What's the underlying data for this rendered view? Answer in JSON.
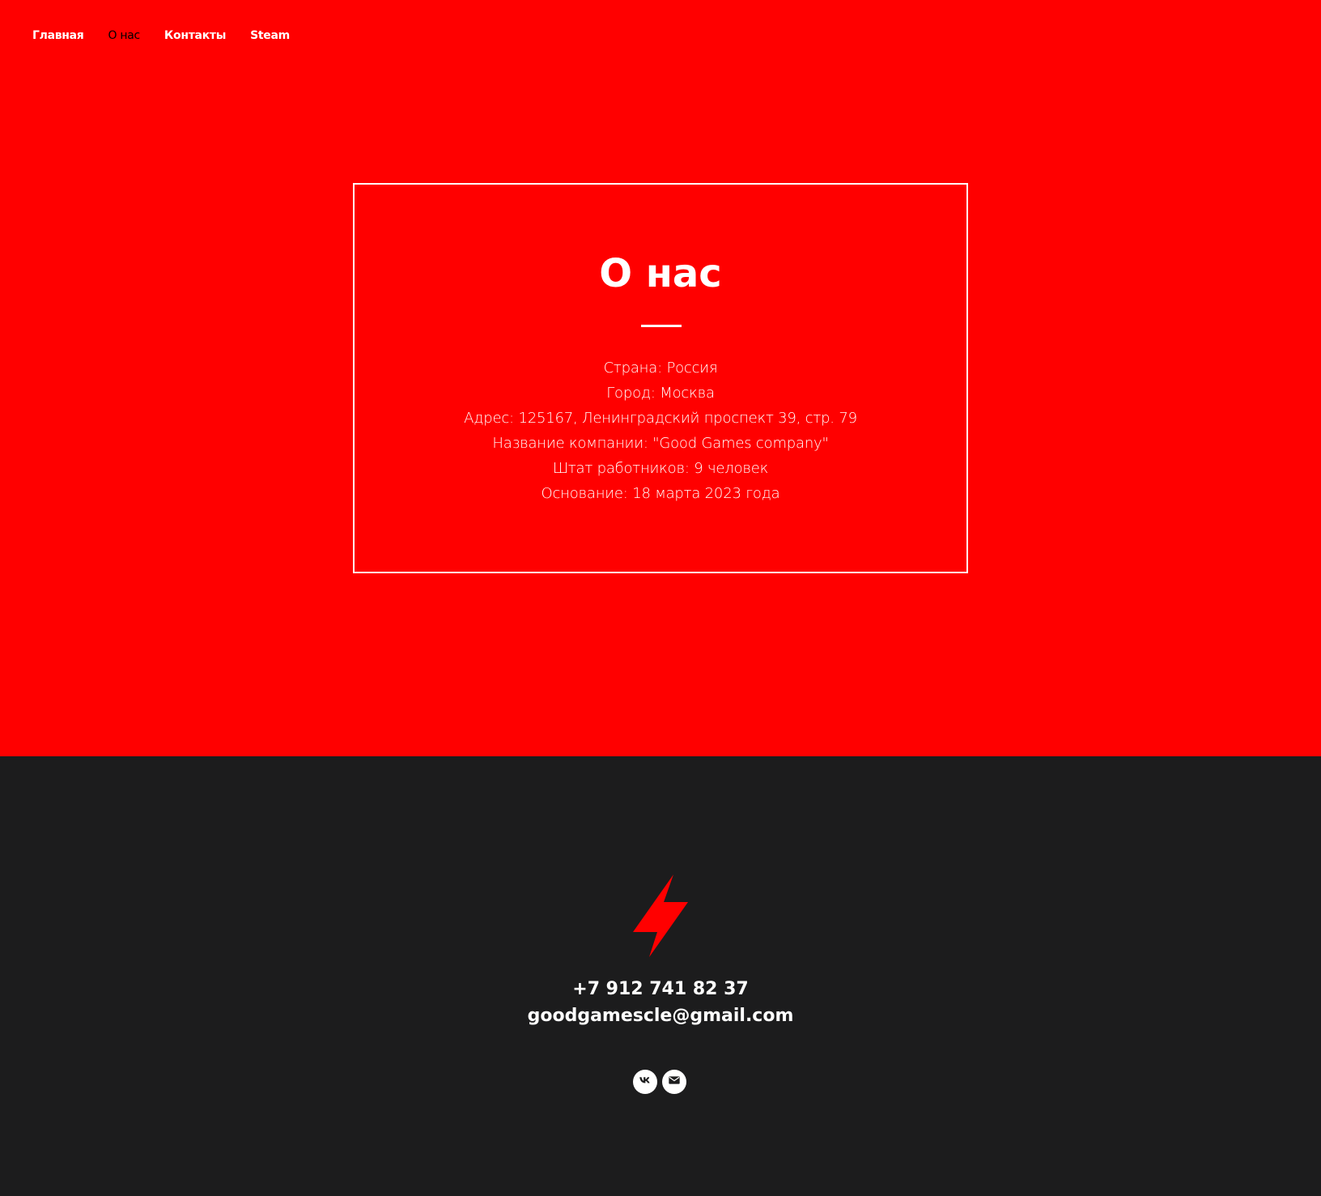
{
  "nav": {
    "items": [
      {
        "label": "Главная",
        "active": false
      },
      {
        "label": "О нас",
        "active": true
      },
      {
        "label": "Контакты",
        "active": false
      },
      {
        "label": "Steam",
        "active": false
      }
    ]
  },
  "about": {
    "title": "О нас",
    "lines": [
      "Страна: Россия",
      "Город: Москва",
      "Адрес: 125167, Ленинградский проспект 39, стр. 79",
      "Название компании: \"Good Games company\"",
      "Штат работников: 9 человек",
      "Основание: 18 марта 2023 года"
    ]
  },
  "footer": {
    "logo_icon": "lightning-bolt-icon",
    "phone": "+7 912 741 82 37",
    "email": "goodgamescle@gmail.com",
    "socials": [
      {
        "icon": "vk-icon"
      },
      {
        "icon": "mail-icon"
      }
    ]
  },
  "colors": {
    "accent": "#ff0000",
    "footer_bg": "#1c1c1d",
    "text": "#ffffff"
  }
}
